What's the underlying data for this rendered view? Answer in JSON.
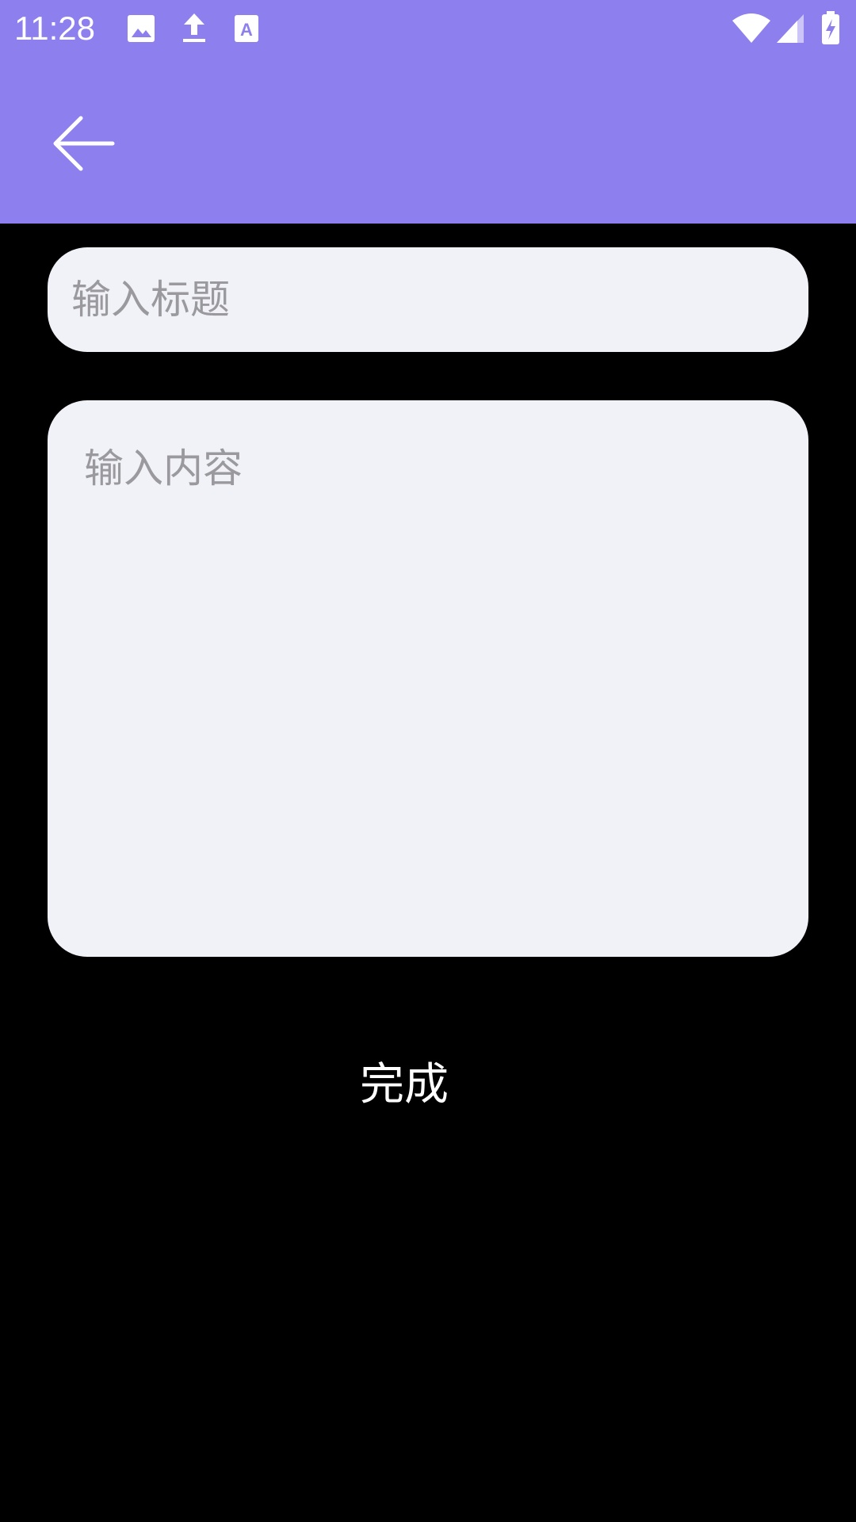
{
  "status_bar": {
    "time": "11:28",
    "left_icons": [
      "image-icon",
      "upload-icon",
      "text-format-icon"
    ],
    "right_icons": [
      "wifi-icon",
      "cell-signal-icon",
      "battery-charging-icon"
    ],
    "background": "#8d80ee"
  },
  "app_bar": {
    "back_icon": "arrow-left-icon",
    "background": "#8d80ee"
  },
  "form": {
    "title_placeholder": "输入标题",
    "title_value": "",
    "content_placeholder": "输入内容",
    "content_value": "",
    "field_background": "#f1f2f7"
  },
  "actions": {
    "done_label": "完成"
  }
}
